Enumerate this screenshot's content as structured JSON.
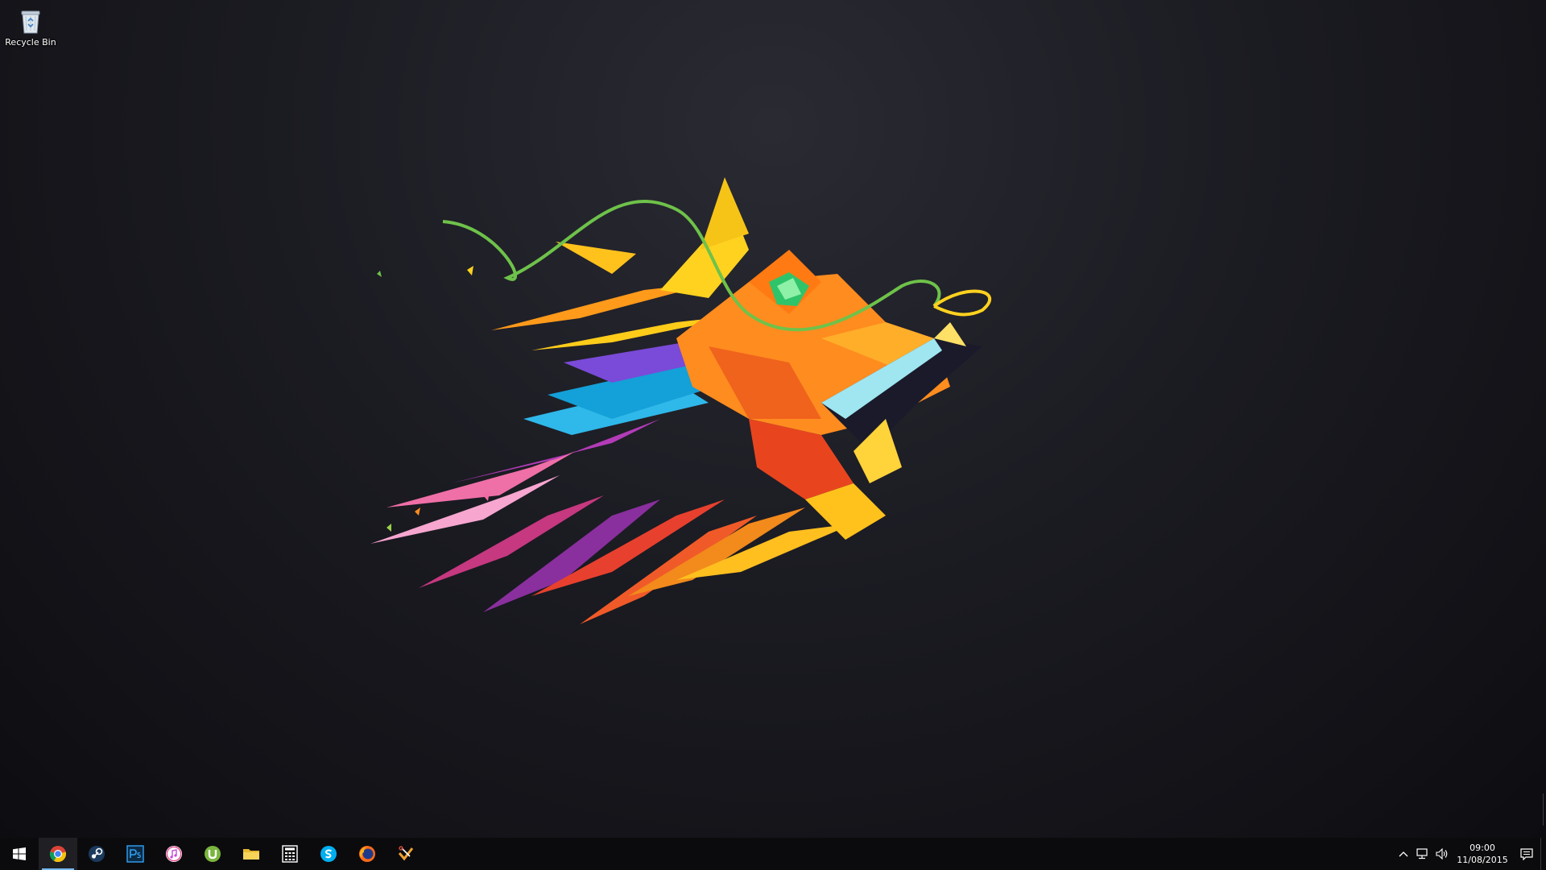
{
  "desktop": {
    "icons": [
      {
        "label": "Recycle Bin",
        "icon": "recycle-bin-icon"
      }
    ],
    "wallpaper": "low-poly-dragon-head"
  },
  "taskbar": {
    "start": {
      "icon": "windows-logo-icon"
    },
    "pinned": [
      {
        "name": "Google Chrome",
        "icon": "chrome-icon",
        "active": true
      },
      {
        "name": "Steam",
        "icon": "steam-icon",
        "active": false
      },
      {
        "name": "Photoshop",
        "icon": "photoshop-icon",
        "active": false
      },
      {
        "name": "iTunes",
        "icon": "itunes-icon",
        "active": false
      },
      {
        "name": "uTorrent",
        "icon": "utorrent-icon",
        "active": false
      },
      {
        "name": "File Explorer",
        "icon": "folder-icon",
        "active": false
      },
      {
        "name": "Calculator",
        "icon": "calculator-icon",
        "active": false
      },
      {
        "name": "Skype",
        "icon": "skype-icon",
        "active": false
      },
      {
        "name": "Firefox",
        "icon": "firefox-icon",
        "active": false
      },
      {
        "name": "Snipping Tool",
        "icon": "snipping-tool-icon",
        "active": false
      }
    ],
    "tray": {
      "icons": [
        "chevron-up-icon",
        "network-icon",
        "volume-icon"
      ],
      "time": "09:00",
      "date": "11/08/2015",
      "notification_icon": "action-center-icon"
    }
  },
  "colors": {
    "taskbar_bg": "#0b0b0d",
    "active_indicator": "#76b9ed",
    "desktop_bg": "#1b1b22"
  }
}
